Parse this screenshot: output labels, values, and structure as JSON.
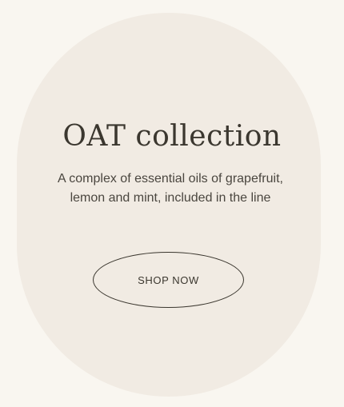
{
  "collection": {
    "title": "OAT collection",
    "description": "A complex of essential oils of grapefruit, lemon and mint, included in the line",
    "button_label": "SHOP NOW"
  },
  "colors": {
    "page_background": "#f9f6f0",
    "card_background": "#f1ebe3",
    "text": "#3b372f"
  }
}
